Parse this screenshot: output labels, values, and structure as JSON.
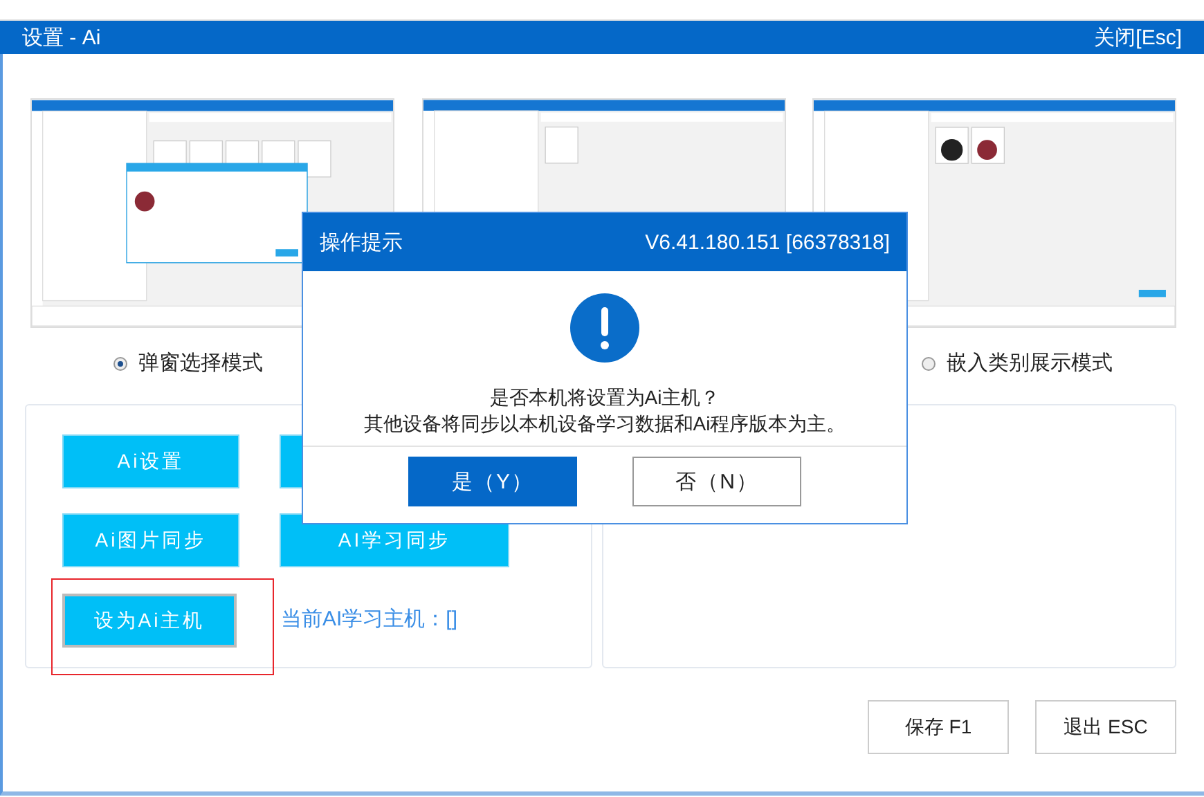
{
  "window": {
    "title": "设置 - Ai",
    "close": "关闭[Esc]"
  },
  "modes": [
    {
      "label": "弹窗选择模式",
      "selected": true
    },
    {
      "label": "嵌入类别展示模式",
      "selected": false
    }
  ],
  "ai_buttons": [
    {
      "kind": "labeled",
      "label": "Ai设置"
    },
    {
      "kind": "covered"
    },
    {
      "kind": "labeled",
      "label": "Ai图片同步"
    },
    {
      "kind": "labeled",
      "label": "AI学习同步"
    }
  ],
  "set_host_button": {
    "label": "设为Ai主机",
    "highlighted": true
  },
  "current_host": "当前AI学习主机：[]",
  "footer_buttons": [
    "保存 F1",
    "退出 ESC"
  ],
  "dialog": {
    "title": "操作提示",
    "version": "V6.41.180.151 [66378318]",
    "message": [
      "是否本机将设置为Ai主机？",
      "其他设备将同步以本机设备学习数据和Ai程序版本为主。"
    ],
    "buttons": [
      {
        "label": "是（Y）",
        "primary": true
      },
      {
        "label": "否（N）",
        "primary": false
      }
    ]
  }
}
